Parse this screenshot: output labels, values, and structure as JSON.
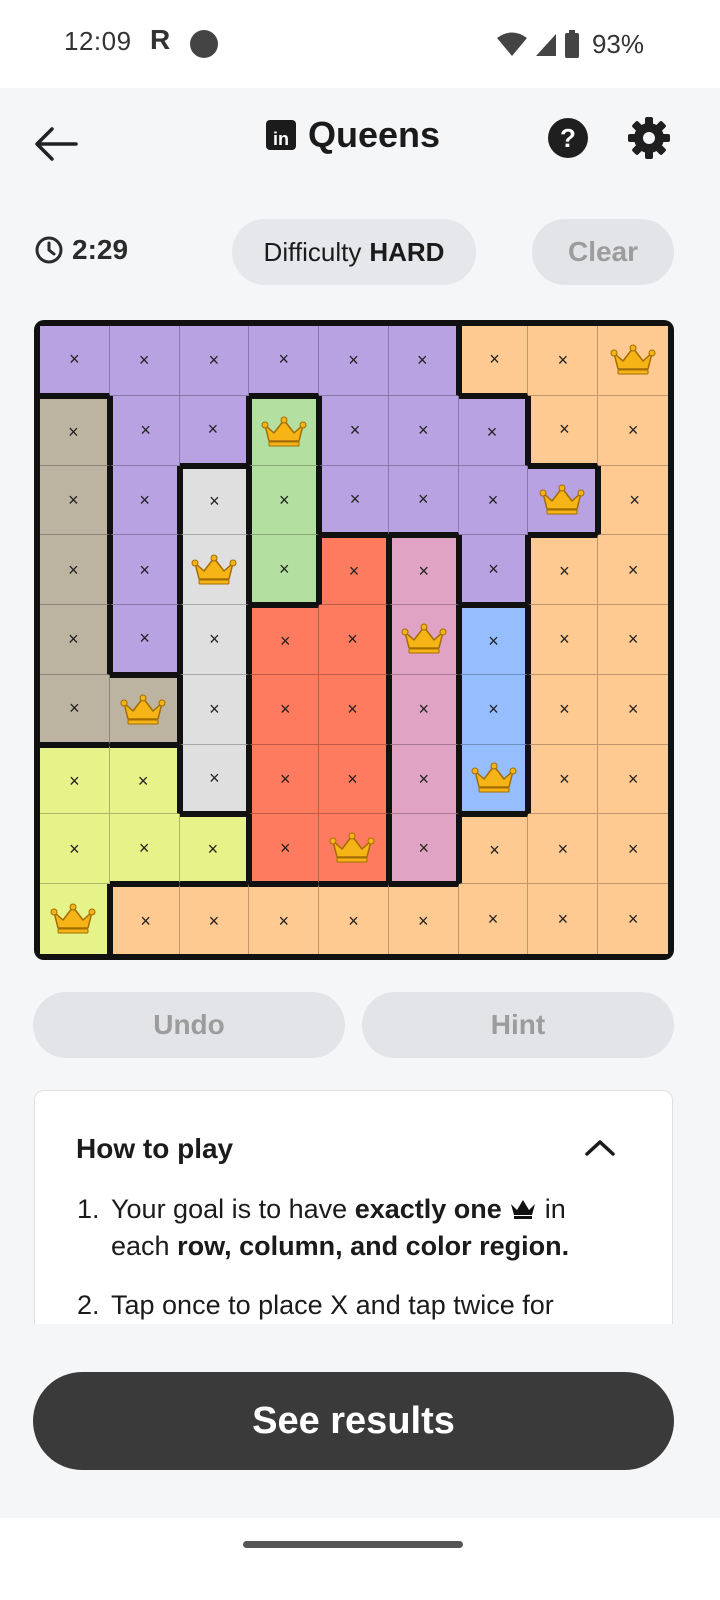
{
  "status_bar": {
    "time": "12:09",
    "carrier_badge": "R",
    "battery": "93%"
  },
  "header": {
    "title": "Queens",
    "logo_text": "in",
    "back_icon": "arrow-left-icon",
    "help_label": "?",
    "settings_icon": "gear-icon"
  },
  "controls": {
    "timer": "2:29",
    "difficulty_label": "Difficulty",
    "difficulty_value": "HARD",
    "clear_label": "Clear"
  },
  "board": {
    "size": 9,
    "colors": {
      "P": "#b9a2e1",
      "O": "#ffc992",
      "T": "#bcb3a0",
      "G": "#b3dfa0",
      "W": "#dfdfdf",
      "R": "#ff7b60",
      "K": "#e0a3c3",
      "B": "#96beff",
      "Y": "#e6f388"
    },
    "regions": [
      [
        "P",
        "P",
        "P",
        "P",
        "P",
        "P",
        "O",
        "O",
        "O"
      ],
      [
        "T",
        "P",
        "P",
        "G",
        "P",
        "P",
        "P",
        "O",
        "O"
      ],
      [
        "T",
        "P",
        "W",
        "G",
        "P",
        "P",
        "P",
        "P",
        "O"
      ],
      [
        "T",
        "P",
        "W",
        "G",
        "R",
        "K",
        "P",
        "O",
        "O"
      ],
      [
        "T",
        "P",
        "W",
        "R",
        "R",
        "K",
        "B",
        "O",
        "O"
      ],
      [
        "T",
        "T",
        "W",
        "R",
        "R",
        "K",
        "B",
        "O",
        "O"
      ],
      [
        "Y",
        "Y",
        "W",
        "R",
        "R",
        "K",
        "B",
        "O",
        "O"
      ],
      [
        "Y",
        "Y",
        "Y",
        "R",
        "R",
        "K",
        "O",
        "O",
        "O"
      ],
      [
        "Y",
        "O",
        "O",
        "O",
        "O",
        "O",
        "O",
        "O",
        "O"
      ]
    ],
    "marks": [
      [
        "x",
        "x",
        "x",
        "x",
        "x",
        "x",
        "x",
        "x",
        "Q"
      ],
      [
        "x",
        "x",
        "x",
        "Q",
        "x",
        "x",
        "x",
        "x",
        "x"
      ],
      [
        "x",
        "x",
        "x",
        "x",
        "x",
        "x",
        "x",
        "Q",
        "x"
      ],
      [
        "x",
        "x",
        "Q",
        "x",
        "x",
        "x",
        "x",
        "x",
        "x"
      ],
      [
        "x",
        "x",
        "x",
        "x",
        "x",
        "Q",
        "x",
        "x",
        "x"
      ],
      [
        "x",
        "Q",
        "x",
        "x",
        "x",
        "x",
        "x",
        "x",
        "x"
      ],
      [
        "x",
        "x",
        "x",
        "x",
        "x",
        "x",
        "Q",
        "x",
        "x"
      ],
      [
        "x",
        "x",
        "x",
        "x",
        "Q",
        "x",
        "x",
        "x",
        "x"
      ],
      [
        "Q",
        "x",
        "x",
        "x",
        "x",
        "x",
        "x",
        "x",
        "x"
      ]
    ],
    "x_symbol": "×"
  },
  "actions": {
    "undo_label": "Undo",
    "hint_label": "Hint"
  },
  "how_to_play": {
    "title": "How to play",
    "rule1_num": "1.",
    "rule1_pre": "Your goal is to have",
    "rule1_bold": "exactly one",
    "rule1_post": "in",
    "rule1_line2_pre": "each",
    "rule1_line2_bold": "row, column, and color region.",
    "rule2_num": "2.",
    "rule2_text": "Tap once to place X and tap twice for"
  },
  "see_results_label": "See results"
}
